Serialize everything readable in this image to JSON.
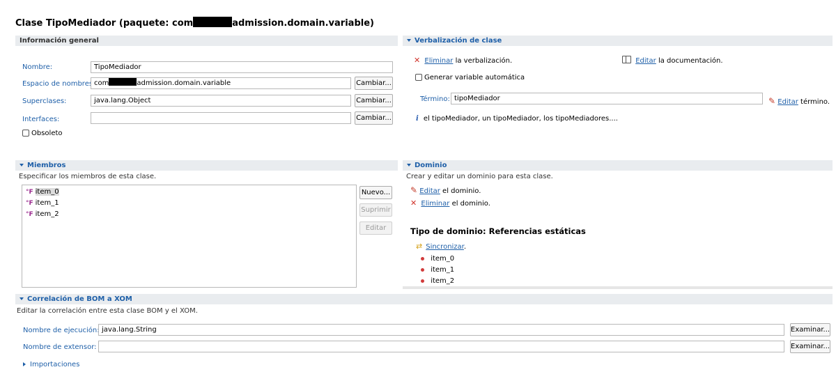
{
  "title": {
    "prefix": "Clase TipoMediador (paquete: com",
    "suffix": "admission.domain.variable)"
  },
  "general": {
    "header": "Información general",
    "name_label": "Nombre:",
    "name_value": "TipoMediador",
    "namespace_label": "Espacio de nombres:",
    "namespace_prefix": "com",
    "namespace_suffix": "admission.domain.variable",
    "superclasses_label": "Superclases:",
    "superclasses_value": "java.lang.Object",
    "interfaces_label": "Interfaces:",
    "interfaces_value": "",
    "change_label": "Cambiar...",
    "obsolete_label": "Obsoleto"
  },
  "verbalization": {
    "header": "Verbalización de clase",
    "delete_link": "Eliminar",
    "delete_text": " la verbalización.",
    "edit_doc_link": "Editar",
    "edit_doc_text": " la documentación.",
    "auto_var_label": "Generar variable automática",
    "term_label": "Término:",
    "term_value": "tipoMediador",
    "edit_term_link": "Editar",
    "edit_term_text": " término.",
    "info_text": "el tipoMediador, un tipoMediador, los tipoMediadores...."
  },
  "members": {
    "header": "Miembros",
    "description": "Especificar los miembros de esta clase.",
    "items": [
      "item_0",
      "item_1",
      "item_2"
    ],
    "new_label": "Nuevo...",
    "delete_label": "Suprimir",
    "edit_label": "Editar"
  },
  "domain": {
    "header": "Dominio",
    "description": "Crear y editar un dominio para esta clase.",
    "edit_link": "Editar",
    "edit_text": " el dominio.",
    "delete_link": "Eliminar",
    "delete_text": " el dominio.",
    "type_title": "Tipo de dominio: Referencias estáticas",
    "sync_link": "Sincronizar",
    "sync_suffix": ".",
    "items": [
      "item_0",
      "item_1",
      "item_2"
    ]
  },
  "bom_xom": {
    "header": "Correlación de BOM a XOM",
    "description": "Editar la correlación entre esta clase BOM y el XOM.",
    "exec_label": "Nombre de ejecución:",
    "exec_value": "java.lang.String",
    "ext_label": "Nombre de extensor:",
    "ext_value": "",
    "browse_label": "Examinar...",
    "imports_label": "Importaciones"
  }
}
